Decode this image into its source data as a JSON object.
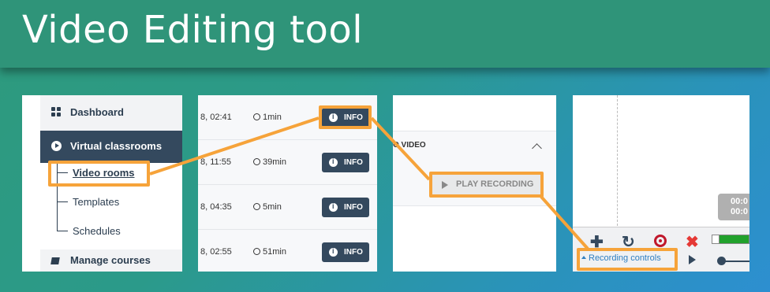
{
  "header": {
    "title": "Video Editing tool"
  },
  "sidebar": {
    "dashboard": "Dashboard",
    "virtual_classrooms": "Virtual classrooms",
    "sub_items": [
      "Video rooms",
      "Templates",
      "Schedules"
    ],
    "manage_courses": "Manage courses"
  },
  "list": {
    "rows": [
      {
        "date": "8, 02:41",
        "duration": "1min",
        "button": "INFO"
      },
      {
        "date": "8, 11:55",
        "duration": "39min",
        "button": "INFO"
      },
      {
        "date": "8, 04:35",
        "duration": "5min",
        "button": "INFO"
      },
      {
        "date": "8, 02:55",
        "duration": "51min",
        "button": "INFO"
      }
    ]
  },
  "recording_panel": {
    "video_label": "O VIDEO",
    "play_button": "PLAY RECORDING"
  },
  "editor": {
    "time_top": "00:0",
    "time_bottom": "00:0",
    "recording_controls": "Recording controls"
  },
  "colors": {
    "header": "#2f9479",
    "highlight": "#f6a33a",
    "nav_dark": "#34495e",
    "record": "#c0172b",
    "close": "#e53935",
    "meter": "#21a12c",
    "link": "#2f7fc1"
  }
}
